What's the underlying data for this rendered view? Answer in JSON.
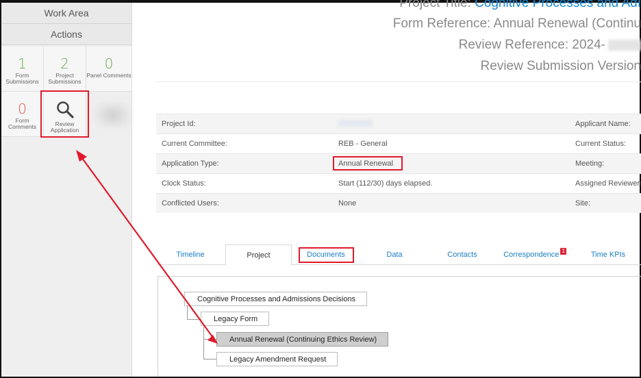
{
  "sidebar": {
    "work_area": "Work Area",
    "actions": "Actions",
    "tiles": [
      {
        "num": "1",
        "label": "Form Submissions",
        "color": "#6aa84f"
      },
      {
        "num": "2",
        "label": "Project Submissions",
        "color": "#6aa84f"
      },
      {
        "num": "0",
        "label": "Panel Comments",
        "color": "#6aa84f"
      },
      {
        "num": "0",
        "label": "Form Comments",
        "color": "#e0574a"
      },
      {
        "label": "Review Application",
        "icon": "search-icon"
      }
    ]
  },
  "header": {
    "project_title_label": "Project Title:",
    "project_title_value": "Cognitive Processes and Adı",
    "form_reference": "Form Reference: Annual Renewal (Continu",
    "review_reference": "Review Reference: 2024-",
    "review_submission": "Review Submission Version"
  },
  "info": [
    {
      "label": "Project Id:",
      "value": "",
      "right": "Applicant Name:"
    },
    {
      "label": "Current Committee:",
      "value": "REB - General",
      "right": "Current Status:"
    },
    {
      "label": "Application Type:",
      "value": "Annual Renewal",
      "right": "Meeting:"
    },
    {
      "label": "Clock Status:",
      "value": "Start (112/30) days elapsed.",
      "right": "Assigned Reviewers"
    },
    {
      "label": "Conflicted Users:",
      "value": "None",
      "right": "Site:"
    }
  ],
  "tabs": [
    {
      "label": "Timeline"
    },
    {
      "label": "Project",
      "active": true
    },
    {
      "label": "Documents"
    },
    {
      "label": "Data"
    },
    {
      "label": "Contacts"
    },
    {
      "label": "Correspondence",
      "badge": "1"
    },
    {
      "label": "Time KPIs"
    }
  ],
  "tree": {
    "root": "Cognitive Processes and Admissions Decisions",
    "legacy_form": "Legacy Form",
    "annual_renewal": "Annual Renewal (Continuing Ethics Review)",
    "legacy_amendment": "Legacy Amendment Request"
  },
  "colors": {
    "accent_link": "#1a8ad4",
    "annotation_red": "#e01a2b",
    "badge_red": "#d9263a"
  }
}
